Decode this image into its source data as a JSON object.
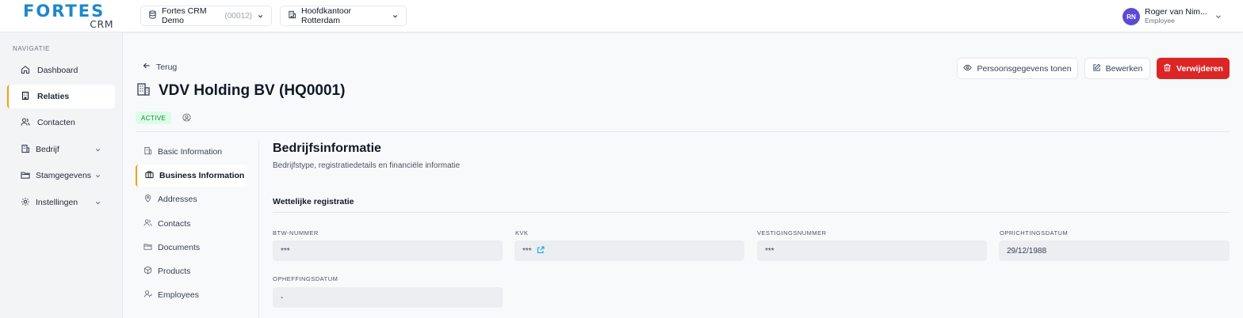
{
  "brand": {
    "name": "FORTES",
    "sub": "CRM",
    "color": "#1e88c9"
  },
  "topbar": {
    "org_name": "Fortes CRM Demo",
    "org_code": "(00012)",
    "location": "Hoofdkantoor Rotterdam"
  },
  "user": {
    "initials": "RN",
    "name": "Roger van Nim...",
    "role": "Employee",
    "avatar_color": "#5b4bd6"
  },
  "sidebar": {
    "heading": "NAVIGATIE",
    "items": [
      {
        "label": "Dashboard",
        "icon": "home-icon"
      },
      {
        "label": "Relaties",
        "icon": "building-icon",
        "active": true
      },
      {
        "label": "Contacten",
        "icon": "users-icon"
      },
      {
        "label": "Bedrijf",
        "icon": "building-icon",
        "has_children": true
      },
      {
        "label": "Stamgegevens",
        "icon": "folder-icon",
        "has_children": true
      },
      {
        "label": "Instellingen",
        "icon": "gear-icon",
        "has_children": true
      }
    ]
  },
  "header": {
    "back_label": "Terug",
    "title": "VDV Holding BV (HQ0001)",
    "status": "ACTIVE",
    "actions": {
      "show_personal": "Persoonsgegevens tonen",
      "edit": "Bewerken",
      "delete": "Verwijderen"
    },
    "delete_color": "#dc2626"
  },
  "sections": [
    {
      "label": "Basic Information",
      "icon": "building-icon"
    },
    {
      "label": "Business Information",
      "icon": "briefcase-icon",
      "active": true
    },
    {
      "label": "Addresses",
      "icon": "map-pin-icon"
    },
    {
      "label": "Contacts",
      "icon": "users-icon"
    },
    {
      "label": "Documents",
      "icon": "folder-icon"
    },
    {
      "label": "Products",
      "icon": "box-icon"
    },
    {
      "label": "Employees",
      "icon": "user-icon"
    }
  ],
  "content": {
    "title": "Bedrijfsinformatie",
    "subtitle": "Bedrijfstype, registratiedetails en financiële informatie",
    "group_title": "Wettelijke registratie",
    "fields": {
      "btw": {
        "label": "BTW-NUMMER",
        "value": "***"
      },
      "kvk": {
        "label": "KVK",
        "value": "***"
      },
      "vestiging": {
        "label": "VESTIGINGSNUMMER",
        "value": "***"
      },
      "oprichting": {
        "label": "OPRICHTINGSDATUM",
        "value": "29/12/1988"
      },
      "opheffing": {
        "label": "OPHEFFINGSDATUM",
        "value": "-"
      }
    }
  },
  "accent_color": "#f59e0b"
}
